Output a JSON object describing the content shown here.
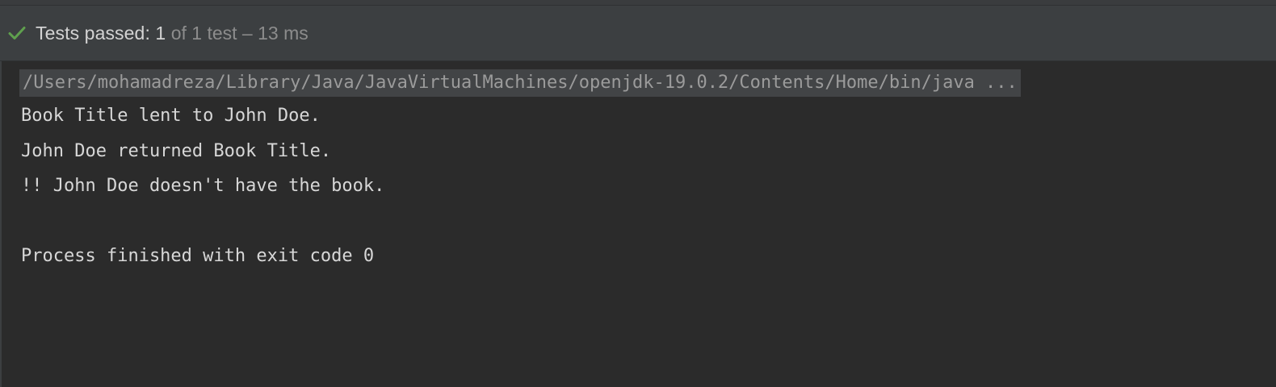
{
  "test_bar": {
    "status_label": "Tests passed: 1",
    "status_detail": " of 1 test – 13 ms",
    "check_icon": "checkmark-icon",
    "check_color": "#5fa04e"
  },
  "console": {
    "command": "/Users/mohamadreza/Library/Java/JavaVirtualMachines/openjdk-19.0.2/Contents/Home/bin/java ...",
    "lines": [
      "Book Title lent to John Doe.",
      "John Doe returned Book Title.",
      "!! John Doe doesn't have the book.",
      "Process finished with exit code 0"
    ]
  }
}
